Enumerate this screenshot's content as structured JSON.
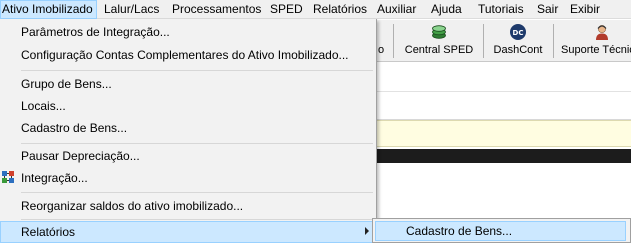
{
  "menubar": {
    "items": [
      {
        "label": "Ativo Imobilizado"
      },
      {
        "label": "Lalur/Lacs"
      },
      {
        "label": "Processamentos"
      },
      {
        "label": "SPED"
      },
      {
        "label": "Relatórios"
      },
      {
        "label": "Auxiliar"
      },
      {
        "label": "Ajuda"
      },
      {
        "label": "Tutoriais"
      },
      {
        "label": "Sair"
      },
      {
        "label": "Exibir"
      }
    ]
  },
  "toolbar": {
    "partial_label": "o",
    "buttons": [
      {
        "label": "Central SPED",
        "icon": "stack-icon"
      },
      {
        "label": "DashCont",
        "icon": "dashcont-icon"
      },
      {
        "label": "Suporte Técnic",
        "icon": "support-person-icon"
      }
    ]
  },
  "dropdown": {
    "items": [
      {
        "label": "Parâmetros de Integração..."
      },
      {
        "label": "Configuração Contas Complementares  do Ativo Imobilizado..."
      },
      {
        "label": "Grupo de Bens..."
      },
      {
        "label": "Locais..."
      },
      {
        "label": "Cadastro de Bens..."
      },
      {
        "label": "Pausar Depreciação..."
      },
      {
        "label": "Integração...",
        "icon": "integration-icon"
      },
      {
        "label": "Reorganizar saldos do ativo imobilizado..."
      },
      {
        "label": "Relatórios",
        "has_submenu": true
      }
    ]
  },
  "submenu": {
    "items": [
      {
        "label": "Cadastro de Bens..."
      }
    ]
  },
  "colors": {
    "highlight_bg": "#cce8ff",
    "highlight_border": "#99d1ff",
    "menu_bg": "#f2f2f2",
    "info_bar": "#fffde1",
    "dark_bar": "#1c1c1c"
  }
}
